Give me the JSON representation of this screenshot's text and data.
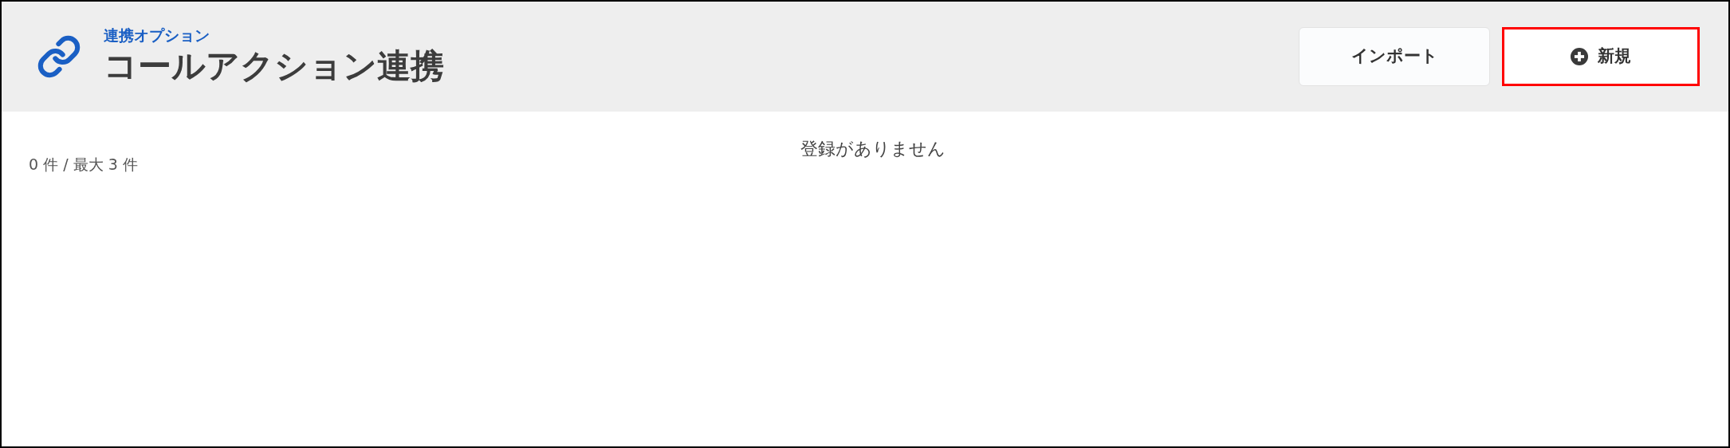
{
  "header": {
    "subtitle": "連携オプション",
    "title": "コールアクション連携"
  },
  "buttons": [
    {
      "kind": "plain",
      "label": "インポート",
      "highlighted": false
    },
    {
      "kind": "add",
      "label": "新規",
      "highlighted": true
    }
  ],
  "count": "0 件 / 最大 3 件",
  "empty_message": "登録がありません"
}
